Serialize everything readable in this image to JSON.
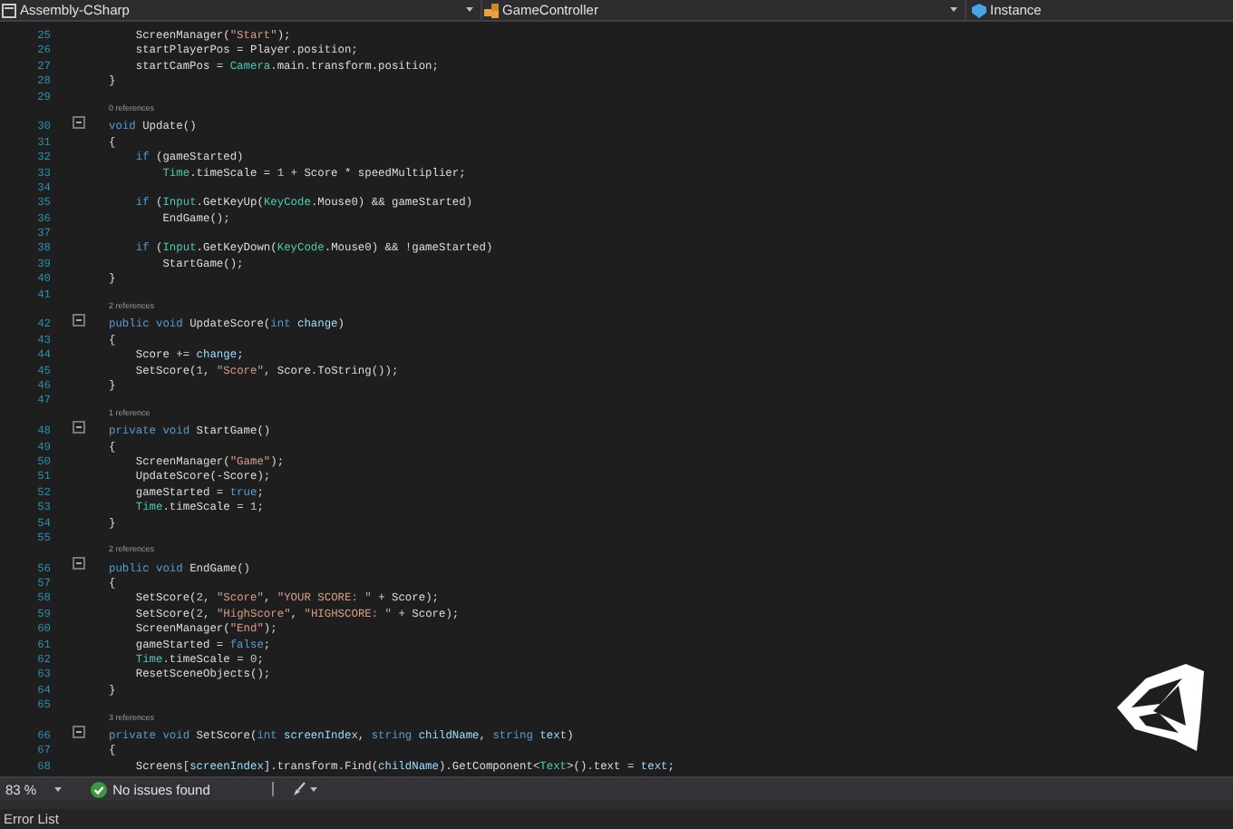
{
  "navigation_bar": [
    {
      "label": "Assembly-CSharp"
    },
    {
      "label": "GameController"
    },
    {
      "label": "Instance"
    }
  ],
  "editor": {
    "lines": [
      {
        "kind": "code",
        "number": "25",
        "fold": false,
        "tokens": [
          {
            "kind": "plain",
            "text": "    ScreenManager("
          },
          {
            "kind": "string",
            "text": "\"Start\""
          },
          {
            "kind": "plain",
            "text": ");"
          }
        ]
      },
      {
        "kind": "code",
        "number": "26",
        "fold": false,
        "tokens": [
          {
            "kind": "plain",
            "text": "    startPlayerPos = Player.position;"
          }
        ]
      },
      {
        "kind": "code",
        "number": "27",
        "fold": false,
        "tokens": [
          {
            "kind": "plain",
            "text": "    startCamPos = "
          },
          {
            "kind": "type",
            "text": "Camera"
          },
          {
            "kind": "plain",
            "text": ".main.transform.position;"
          }
        ]
      },
      {
        "kind": "code",
        "number": "28",
        "fold": false,
        "tokens": [
          {
            "kind": "plain",
            "text": "}"
          }
        ]
      },
      {
        "kind": "code",
        "number": "29",
        "fold": false
      },
      {
        "kind": "codelens",
        "text": "0 references"
      },
      {
        "kind": "code",
        "number": "30",
        "fold": true,
        "tokens": [
          {
            "kind": "keyword",
            "text": "void"
          },
          {
            "kind": "plain",
            "text": " Update()"
          }
        ]
      },
      {
        "kind": "code",
        "number": "31",
        "fold": false,
        "tokens": [
          {
            "kind": "plain",
            "text": "{"
          }
        ]
      },
      {
        "kind": "code",
        "number": "32",
        "fold": false,
        "tokens": [
          {
            "kind": "keyword",
            "text": "    if"
          },
          {
            "kind": "plain",
            "text": " (gameStarted)"
          }
        ]
      },
      {
        "kind": "code",
        "number": "33",
        "fold": false,
        "tokens": [
          {
            "kind": "type",
            "text": "        Time"
          },
          {
            "kind": "plain",
            "text": ".timeScale = "
          },
          {
            "kind": "number",
            "text": "1"
          },
          {
            "kind": "plain",
            "text": " + Score * speedMultiplier;"
          }
        ]
      },
      {
        "kind": "code",
        "number": "34",
        "fold": false
      },
      {
        "kind": "code",
        "number": "35",
        "fold": false,
        "tokens": [
          {
            "kind": "keyword",
            "text": "    if"
          },
          {
            "kind": "plain",
            "text": " ("
          },
          {
            "kind": "type",
            "text": "Input"
          },
          {
            "kind": "plain",
            "text": ".GetKeyUp("
          },
          {
            "kind": "type",
            "text": "KeyCode"
          },
          {
            "kind": "plain",
            "text": ".Mouse0) && gameStarted)"
          }
        ]
      },
      {
        "kind": "code",
        "number": "36",
        "fold": false,
        "tokens": [
          {
            "kind": "plain",
            "text": "        EndGame();"
          }
        ]
      },
      {
        "kind": "code",
        "number": "37",
        "fold": false
      },
      {
        "kind": "code",
        "number": "38",
        "fold": false,
        "tokens": [
          {
            "kind": "keyword",
            "text": "    if"
          },
          {
            "kind": "plain",
            "text": " ("
          },
          {
            "kind": "type",
            "text": "Input"
          },
          {
            "kind": "plain",
            "text": ".GetKeyDown("
          },
          {
            "kind": "type",
            "text": "KeyCode"
          },
          {
            "kind": "plain",
            "text": ".Mouse0) && !gameStarted)"
          }
        ]
      },
      {
        "kind": "code",
        "number": "39",
        "fold": false,
        "tokens": [
          {
            "kind": "plain",
            "text": "        StartGame();"
          }
        ]
      },
      {
        "kind": "code",
        "number": "40",
        "fold": false,
        "tokens": [
          {
            "kind": "plain",
            "text": "}"
          }
        ]
      },
      {
        "kind": "code",
        "number": "41",
        "fold": false
      },
      {
        "kind": "codelens",
        "text": "2 references"
      },
      {
        "kind": "code",
        "number": "42",
        "fold": true,
        "tokens": [
          {
            "kind": "keyword",
            "text": "public void"
          },
          {
            "kind": "plain",
            "text": " UpdateScore("
          },
          {
            "kind": "keyword",
            "text": "int"
          },
          {
            "kind": "param",
            "text": " change"
          },
          {
            "kind": "plain",
            "text": ")"
          }
        ]
      },
      {
        "kind": "code",
        "number": "43",
        "fold": false,
        "tokens": [
          {
            "kind": "plain",
            "text": "{"
          }
        ]
      },
      {
        "kind": "code",
        "number": "44",
        "fold": false,
        "tokens": [
          {
            "kind": "plain",
            "text": "    Score += "
          },
          {
            "kind": "param",
            "text": "change"
          },
          {
            "kind": "plain",
            "text": ";"
          }
        ]
      },
      {
        "kind": "code",
        "number": "45",
        "fold": false,
        "tokens": [
          {
            "kind": "plain",
            "text": "    SetScore("
          },
          {
            "kind": "number",
            "text": "1"
          },
          {
            "kind": "plain",
            "text": ", "
          },
          {
            "kind": "string",
            "text": "\"Score\""
          },
          {
            "kind": "plain",
            "text": ", Score.ToString());"
          }
        ]
      },
      {
        "kind": "code",
        "number": "46",
        "fold": false,
        "tokens": [
          {
            "kind": "plain",
            "text": "}"
          }
        ]
      },
      {
        "kind": "code",
        "number": "47",
        "fold": false
      },
      {
        "kind": "codelens",
        "text": "1 reference"
      },
      {
        "kind": "code",
        "number": "48",
        "fold": true,
        "tokens": [
          {
            "kind": "keyword",
            "text": "private void"
          },
          {
            "kind": "plain",
            "text": " StartGame()"
          }
        ]
      },
      {
        "kind": "code",
        "number": "49",
        "fold": false,
        "tokens": [
          {
            "kind": "plain",
            "text": "{"
          }
        ]
      },
      {
        "kind": "code",
        "number": "50",
        "fold": false,
        "tokens": [
          {
            "kind": "plain",
            "text": "    ScreenManager("
          },
          {
            "kind": "string",
            "text": "\"Game\""
          },
          {
            "kind": "plain",
            "text": ");"
          }
        ]
      },
      {
        "kind": "code",
        "number": "51",
        "fold": false,
        "tokens": [
          {
            "kind": "plain",
            "text": "    UpdateScore(-Score);"
          }
        ]
      },
      {
        "kind": "code",
        "number": "52",
        "fold": false,
        "tokens": [
          {
            "kind": "plain",
            "text": "    gameStarted = "
          },
          {
            "kind": "keyword",
            "text": "true"
          },
          {
            "kind": "plain",
            "text": ";"
          }
        ]
      },
      {
        "kind": "code",
        "number": "53",
        "fold": false,
        "tokens": [
          {
            "kind": "type",
            "text": "    Time"
          },
          {
            "kind": "plain",
            "text": ".timeScale = "
          },
          {
            "kind": "number",
            "text": "1"
          },
          {
            "kind": "plain",
            "text": ";"
          }
        ]
      },
      {
        "kind": "code",
        "number": "54",
        "fold": false,
        "tokens": [
          {
            "kind": "plain",
            "text": "}"
          }
        ]
      },
      {
        "kind": "code",
        "number": "55",
        "fold": false
      },
      {
        "kind": "codelens",
        "text": "2 references"
      },
      {
        "kind": "code",
        "number": "56",
        "fold": true,
        "tokens": [
          {
            "kind": "keyword",
            "text": "public void"
          },
          {
            "kind": "plain",
            "text": " EndGame()"
          }
        ]
      },
      {
        "kind": "code",
        "number": "57",
        "fold": false,
        "tokens": [
          {
            "kind": "plain",
            "text": "{"
          }
        ]
      },
      {
        "kind": "code",
        "number": "58",
        "fold": false,
        "tokens": [
          {
            "kind": "plain",
            "text": "    SetScore("
          },
          {
            "kind": "number",
            "text": "2"
          },
          {
            "kind": "plain",
            "text": ", "
          },
          {
            "kind": "string",
            "text": "\"Score\""
          },
          {
            "kind": "plain",
            "text": ", "
          },
          {
            "kind": "string",
            "text": "\"YOUR SCORE: \""
          },
          {
            "kind": "plain",
            "text": " + Score);"
          }
        ]
      },
      {
        "kind": "code",
        "number": "59",
        "fold": false,
        "tokens": [
          {
            "kind": "plain",
            "text": "    SetScore("
          },
          {
            "kind": "number",
            "text": "2"
          },
          {
            "kind": "plain",
            "text": ", "
          },
          {
            "kind": "string",
            "text": "\"HighScore\""
          },
          {
            "kind": "plain",
            "text": ", "
          },
          {
            "kind": "string",
            "text": "\"HIGHSCORE: \""
          },
          {
            "kind": "plain",
            "text": " + Score);"
          }
        ]
      },
      {
        "kind": "code",
        "number": "60",
        "fold": false,
        "tokens": [
          {
            "kind": "plain",
            "text": "    ScreenManager("
          },
          {
            "kind": "string",
            "text": "\"End\""
          },
          {
            "kind": "plain",
            "text": ");"
          }
        ]
      },
      {
        "kind": "code",
        "number": "61",
        "fold": false,
        "tokens": [
          {
            "kind": "plain",
            "text": "    gameStarted = "
          },
          {
            "kind": "keyword",
            "text": "false"
          },
          {
            "kind": "plain",
            "text": ";"
          }
        ]
      },
      {
        "kind": "code",
        "number": "62",
        "fold": false,
        "tokens": [
          {
            "kind": "type",
            "text": "    Time"
          },
          {
            "kind": "plain",
            "text": ".timeScale = "
          },
          {
            "kind": "number",
            "text": "0"
          },
          {
            "kind": "plain",
            "text": ";"
          }
        ]
      },
      {
        "kind": "code",
        "number": "63",
        "fold": false,
        "tokens": [
          {
            "kind": "plain",
            "text": "    ResetSceneObjects();"
          }
        ]
      },
      {
        "kind": "code",
        "number": "64",
        "fold": false,
        "tokens": [
          {
            "kind": "plain",
            "text": "}"
          }
        ]
      },
      {
        "kind": "code",
        "number": "65",
        "fold": false
      },
      {
        "kind": "codelens",
        "text": "3 references"
      },
      {
        "kind": "code",
        "number": "66",
        "fold": true,
        "tokens": [
          {
            "kind": "keyword",
            "text": "private void"
          },
          {
            "kind": "plain",
            "text": " SetScore("
          },
          {
            "kind": "keyword",
            "text": "int"
          },
          {
            "kind": "param",
            "text": " screenIndex"
          },
          {
            "kind": "plain",
            "text": ", "
          },
          {
            "kind": "keyword",
            "text": "string"
          },
          {
            "kind": "param",
            "text": " childName"
          },
          {
            "kind": "plain",
            "text": ", "
          },
          {
            "kind": "keyword",
            "text": "string"
          },
          {
            "kind": "param",
            "text": " text"
          },
          {
            "kind": "plain",
            "text": ")"
          }
        ]
      },
      {
        "kind": "code",
        "number": "67",
        "fold": false,
        "tokens": [
          {
            "kind": "plain",
            "text": "{"
          }
        ]
      },
      {
        "kind": "code",
        "number": "68",
        "fold": false,
        "tokens": [
          {
            "kind": "plain",
            "text": "    Screens["
          },
          {
            "kind": "param",
            "text": "screenIndex"
          },
          {
            "kind": "plain",
            "text": "].transform.Find("
          },
          {
            "kind": "param",
            "text": "childName"
          },
          {
            "kind": "plain",
            "text": ").GetComponent<"
          },
          {
            "kind": "type",
            "text": "Text"
          },
          {
            "kind": "plain",
            "text": ">().text = "
          },
          {
            "kind": "param",
            "text": "text"
          },
          {
            "kind": "plain",
            "text": ";"
          }
        ]
      }
    ]
  },
  "status_bar": {
    "zoom": "83 %",
    "issues": "No issues found"
  },
  "bottom_panel": {
    "tab": "Error List"
  }
}
